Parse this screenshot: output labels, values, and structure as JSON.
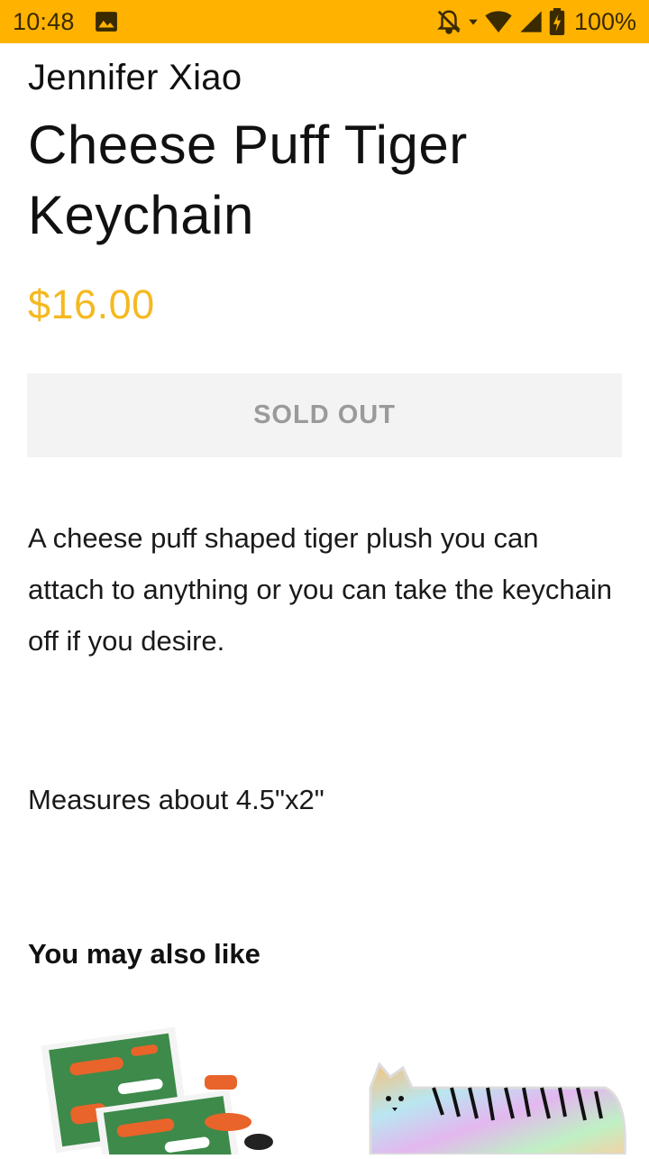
{
  "status_bar": {
    "time": "10:48",
    "battery": "100%",
    "bg_color": "#FFB300",
    "icons": [
      "image-notification-icon",
      "bell-off-icon",
      "wifi-icon",
      "cell-signal-icon",
      "battery-icon"
    ]
  },
  "product": {
    "vendor": "Jennifer Xiao",
    "title": "Cheese Puff Tiger Keychain",
    "price": "$16.00",
    "price_color": "#F5B920",
    "button_label": "SOLD OUT",
    "description": "A cheese puff shaped tiger plush you can attach to anything or you can take the keychain off if you desire.",
    "measures": "Measures about 4.5\"x2\""
  },
  "recommendations": {
    "heading": "You may also like",
    "items": [
      {
        "image": "tiger-sticker-sheets-image"
      },
      {
        "image": "holographic-tiger-sticker-image"
      }
    ]
  }
}
